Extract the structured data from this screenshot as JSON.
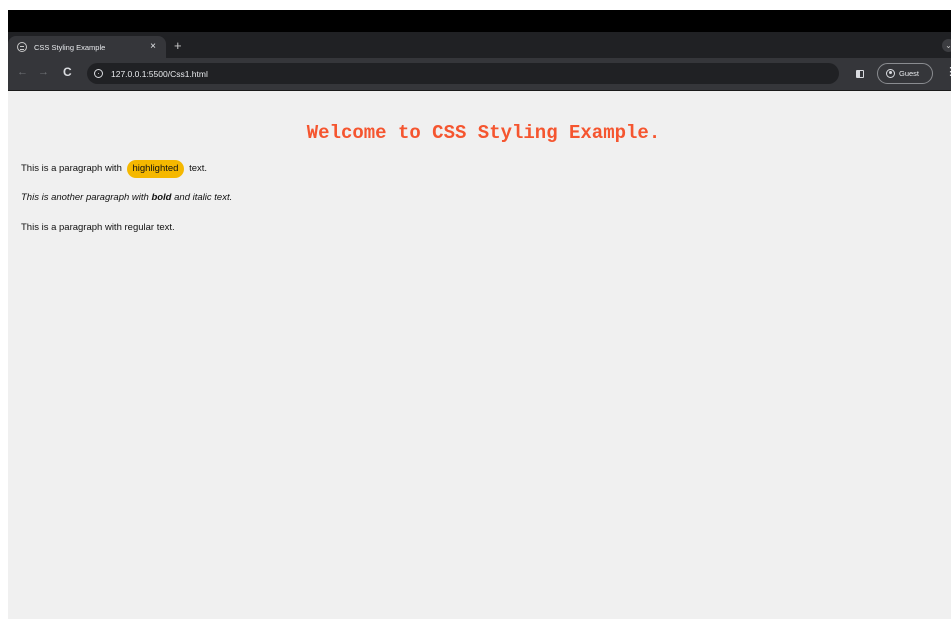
{
  "browser": {
    "tab": {
      "title": "CSS Styling Example",
      "close_glyph": "×",
      "favicon": "globe-icon"
    },
    "new_tab_glyph": "+",
    "tab_search_glyph": "⌄",
    "nav": {
      "back_glyph": "←",
      "forward_glyph": "→",
      "reload_glyph": "C"
    },
    "address": {
      "url": "127.0.0.1:5500/Css1.html",
      "icon": "site-info-icon"
    },
    "profile": {
      "label": "Guest",
      "icon": "person-circle-icon"
    },
    "menu_glyph": "⋮",
    "colors": {
      "titlebar": "#000000",
      "tabstrip": "#202124",
      "toolbar": "#35363a",
      "omnibox": "#202124"
    }
  },
  "page": {
    "background": "#f0f0f0",
    "heading": {
      "text": "Welcome to CSS Styling Example.",
      "color": "#f5552f"
    },
    "paragraph_1": {
      "before": "This is a paragraph with",
      "highlight": "highlighted",
      "after": "text.",
      "highlight_color": "#f5b800"
    },
    "paragraph_2": {
      "before": "This is another paragraph with",
      "bold": "bold",
      "after": "and italic text."
    },
    "paragraph_3": {
      "text": "This is a paragraph with regular text."
    }
  }
}
